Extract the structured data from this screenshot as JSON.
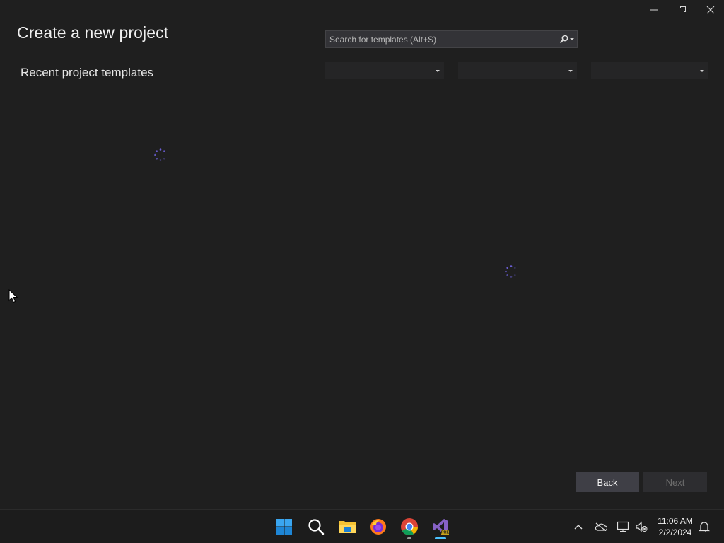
{
  "window": {
    "title": "Create a new project",
    "recent_heading": "Recent project templates",
    "controls": [
      "minimize-icon",
      "restore-icon",
      "close-icon"
    ]
  },
  "search": {
    "placeholder": "Search for templates (Alt+S)",
    "value": ""
  },
  "filters": [
    {
      "name": "language-filter",
      "value": ""
    },
    {
      "name": "platform-filter",
      "value": ""
    },
    {
      "name": "project-type-filter",
      "value": ""
    }
  ],
  "buttons": {
    "back": "Back",
    "next": "Next"
  },
  "taskbar": {
    "apps": [
      "start-icon",
      "search-icon",
      "file-explorer-icon",
      "firefox-icon",
      "chrome-icon",
      "visual-studio-icon"
    ],
    "tray": [
      "chevron-up-icon",
      "onedrive-icon",
      "network-icon",
      "volume-muted-icon",
      "notification-bell-icon"
    ],
    "time": "11:06 AM",
    "date": "2/2/2024"
  },
  "colors": {
    "background": "#1f1f1f",
    "spinner": "#6b5fd6",
    "accent_indicator": "#4cc2ff"
  }
}
